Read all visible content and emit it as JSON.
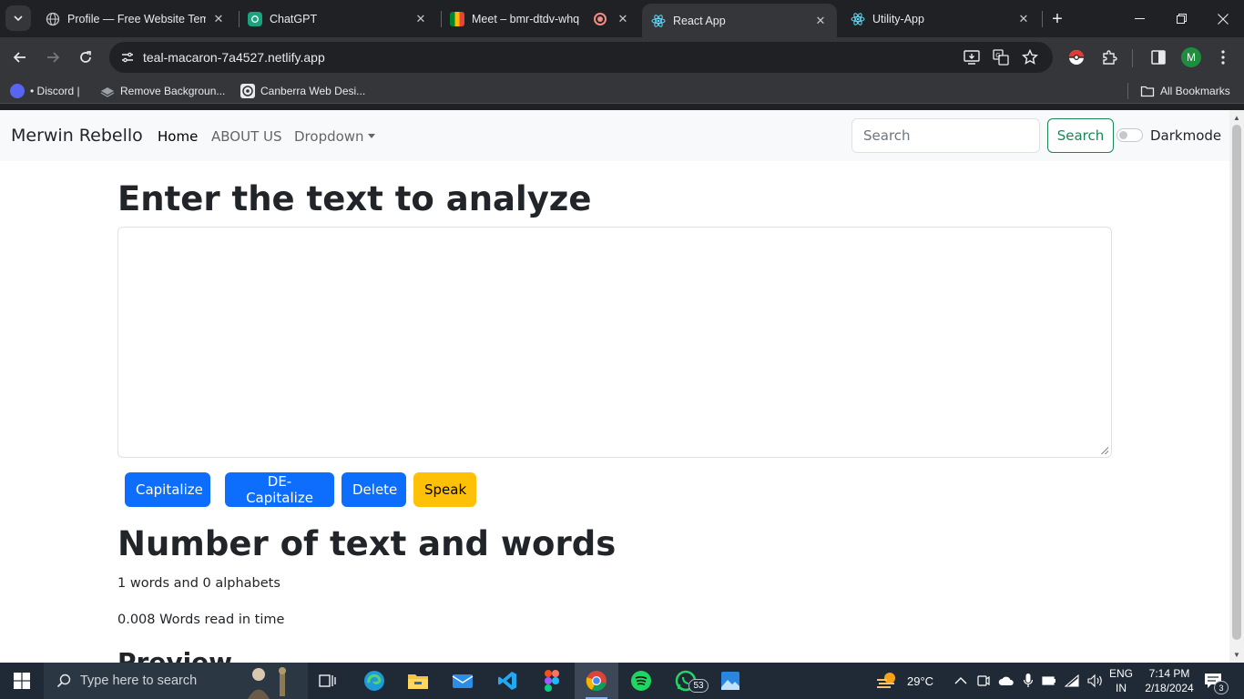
{
  "browser": {
    "tabs": [
      {
        "title": "Profile — Free Website Temp",
        "icon": "globe-icon"
      },
      {
        "title": "ChatGPT",
        "icon": "chatgpt-icon"
      },
      {
        "title": "Meet – bmr-dtdv-whq",
        "icon": "meet-icon"
      },
      {
        "title": "React App",
        "icon": "react-icon"
      },
      {
        "title": "Utility-App",
        "icon": "react-icon"
      }
    ],
    "active_tab": 3,
    "url": "teal-macaron-7a4527.netlify.app",
    "profile_initial": "M",
    "bookmarks": [
      {
        "label": "• Discord |",
        "icon": "discord-icon"
      },
      {
        "label": "Remove Backgroun...",
        "icon": "layers-icon"
      },
      {
        "label": "Canberra Web Desi...",
        "icon": "site-icon"
      }
    ],
    "all_bookmarks_label": "All Bookmarks"
  },
  "navbar": {
    "brand": "Merwin Rebello",
    "links": [
      "Home",
      "ABOUT US",
      "Dropdown"
    ],
    "search_placeholder": "Search",
    "search_button": "Search",
    "darkmode_label": "Darkmode"
  },
  "main": {
    "heading": "Enter the text to analyze",
    "textarea_value": "",
    "buttons": [
      "Capitalize",
      "DE-Capitalize",
      "Delete",
      "Speak"
    ],
    "summary_heading": "Number of text and words",
    "word_count_text": "1 words and 0 alphabets",
    "read_time_text": "0.008 Words read in time",
    "preview_heading": "Preview"
  },
  "taskbar": {
    "search_placeholder": "Type here to search",
    "whatsapp_badge": "53",
    "weather": "29°C",
    "lang_line1": "ENG",
    "lang_line2": "IN",
    "time": "7:14 PM",
    "date": "2/18/2024",
    "notification_count": "3"
  },
  "colors": {
    "primary": "#0d6efd",
    "warning": "#ffc107",
    "success": "#198754",
    "chrome_dark": "#202124",
    "chrome_toolbar": "#35363a"
  }
}
